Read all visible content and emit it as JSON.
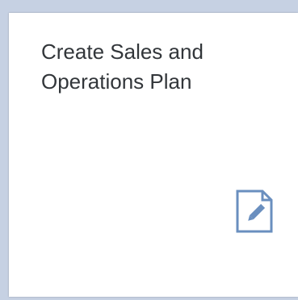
{
  "tile": {
    "title": "Create Sales and Operations Plan",
    "icon": "edit-document-icon",
    "icon_color": "#6a8fbf",
    "background": "#ffffff",
    "title_color": "#32363a"
  },
  "page": {
    "background": "#c6d1e3"
  }
}
